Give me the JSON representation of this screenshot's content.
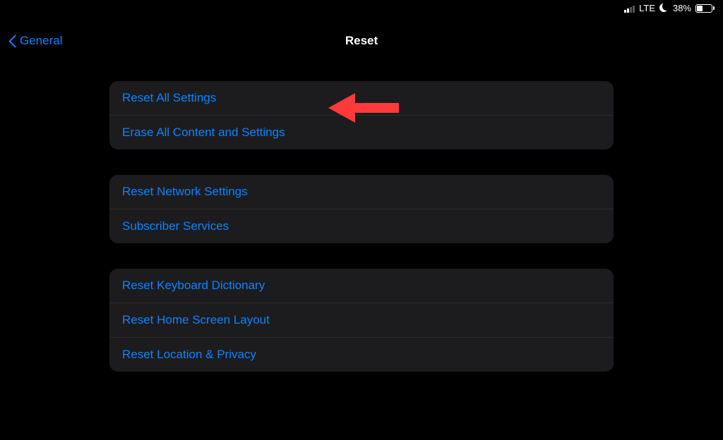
{
  "status": {
    "network": "LTE",
    "battery_pct": "38%"
  },
  "nav": {
    "back_label": "General",
    "title": "Reset"
  },
  "groups": [
    {
      "items": [
        {
          "name": "reset-all-settings",
          "label": "Reset All Settings"
        },
        {
          "name": "erase-all-content",
          "label": "Erase All Content and Settings"
        }
      ]
    },
    {
      "items": [
        {
          "name": "reset-network-settings",
          "label": "Reset Network Settings"
        },
        {
          "name": "subscriber-services",
          "label": "Subscriber Services"
        }
      ]
    },
    {
      "items": [
        {
          "name": "reset-keyboard-dictionary",
          "label": "Reset Keyboard Dictionary"
        },
        {
          "name": "reset-home-screen-layout",
          "label": "Reset Home Screen Layout"
        },
        {
          "name": "reset-location-privacy",
          "label": "Reset Location & Privacy"
        }
      ]
    }
  ]
}
